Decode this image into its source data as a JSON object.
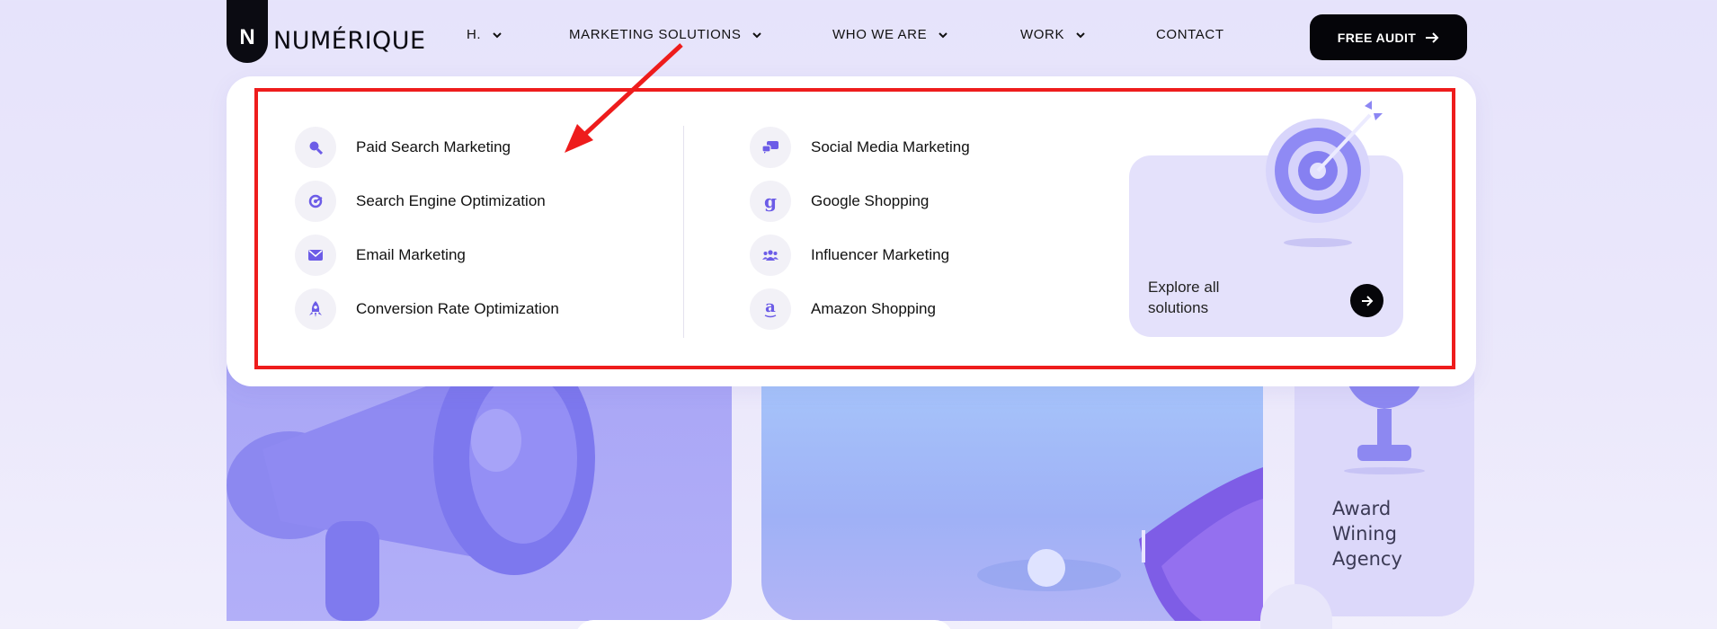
{
  "brand": {
    "badge": "N",
    "name": "NUMÉRIQUE"
  },
  "nav": {
    "items": [
      {
        "label": "H.",
        "has_dropdown": true
      },
      {
        "label": "MARKETING SOLUTIONS",
        "has_dropdown": true
      },
      {
        "label": "WHO WE ARE",
        "has_dropdown": true
      },
      {
        "label": "WORK",
        "has_dropdown": true
      },
      {
        "label": "CONTACT",
        "has_dropdown": false
      }
    ],
    "cta_label": "FREE AUDIT"
  },
  "menu": {
    "left": [
      {
        "label": "Paid Search Marketing",
        "icon": "search-icon"
      },
      {
        "label": "Search Engine Optimization",
        "icon": "seo-target-icon"
      },
      {
        "label": "Email Marketing",
        "icon": "envelope-icon"
      },
      {
        "label": "Conversion Rate Optimization",
        "icon": "rocket-icon"
      }
    ],
    "right": [
      {
        "label": "Social Media Marketing",
        "icon": "chat-bubbles-icon"
      },
      {
        "label": "Google Shopping",
        "icon": "google-g-icon",
        "glyph": "g"
      },
      {
        "label": "Influencer Marketing",
        "icon": "people-icon"
      },
      {
        "label": "Amazon Shopping",
        "icon": "amazon-icon",
        "glyph": "a"
      }
    ],
    "explore_label": "Explore all solutions"
  },
  "cards": {
    "award_text": "Award Wining Agency"
  },
  "colors": {
    "accent": "#6c5ce7",
    "highlight": "#ee1c1c",
    "background": "#e6e3fb"
  }
}
